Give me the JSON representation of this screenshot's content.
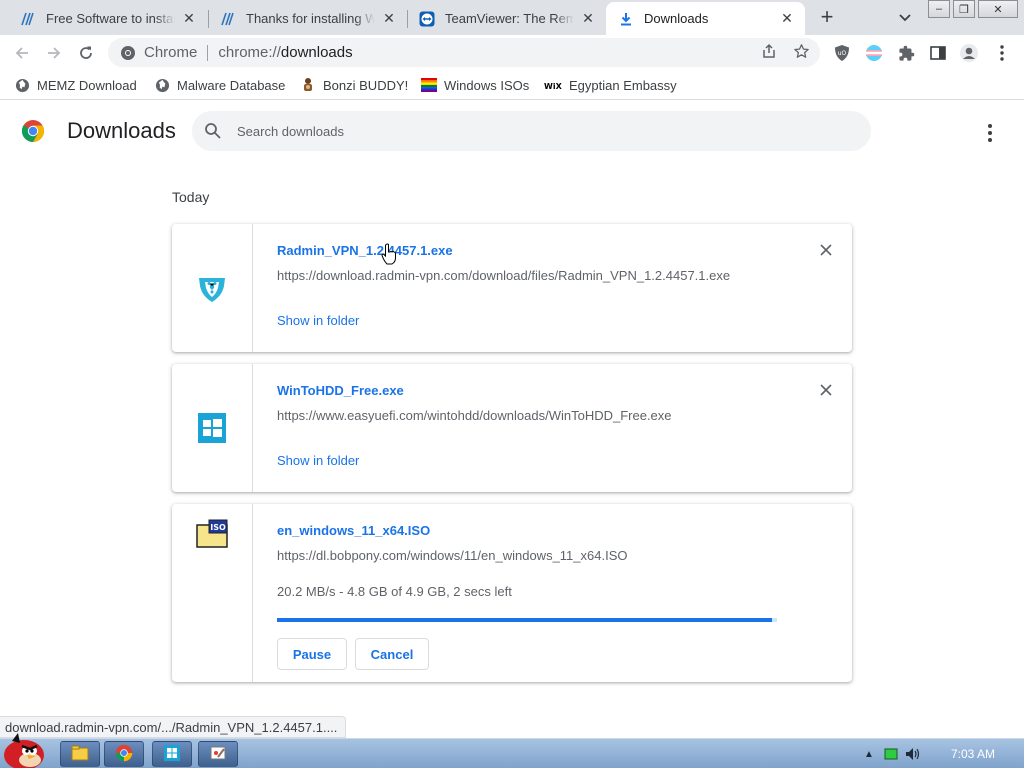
{
  "tabs": [
    {
      "title": "Free Software to install",
      "icon": "ninite-icon",
      "active": false
    },
    {
      "title": "Thanks for installing Wi",
      "icon": "ninite-icon",
      "active": false
    },
    {
      "title": "TeamViewer: The Remo",
      "icon": "teamviewer-icon",
      "active": false
    },
    {
      "title": "Downloads",
      "icon": "download-icon",
      "active": true
    }
  ],
  "window_controls": {
    "minimize": "–",
    "restore": "❐",
    "close": "✕"
  },
  "omnibox": {
    "scheme_label": "Chrome",
    "url_prefix": "chrome://",
    "url_host": "downloads"
  },
  "bookmarks": [
    {
      "label": "MEMZ Download",
      "icon": "globe-icon"
    },
    {
      "label": "Malware Database",
      "icon": "globe-icon"
    },
    {
      "label": "Bonzi BUDDY!",
      "icon": "bonzi-icon"
    },
    {
      "label": "Windows ISOs",
      "icon": "rainbow-flag-icon"
    },
    {
      "label": "Egyptian Embassy",
      "icon": "wix-icon"
    }
  ],
  "page": {
    "title": "Downloads",
    "search_placeholder": "Search downloads",
    "date_label": "Today"
  },
  "downloads": [
    {
      "filename": "Radmin_VPN_1.2.4457.1.exe",
      "url": "https://download.radmin-vpn.com/download/files/Radmin_VPN_1.2.4457.1.exe",
      "action": "Show in folder",
      "icon": "radmin-vpn-icon",
      "state": "complete"
    },
    {
      "filename": "WinToHDD_Free.exe",
      "url": "https://www.easyuefi.com/wintohdd/downloads/WinToHDD_Free.exe",
      "action": "Show in folder",
      "icon": "windows-logo-icon",
      "state": "complete"
    },
    {
      "filename": "en_windows_11_x64.ISO",
      "url": "https://dl.bobpony.com/windows/11/en_windows_11_x64.ISO",
      "status": "20.2 MB/s - 4.8 GB of 4.9 GB, 2 secs left",
      "progress_fraction": 0.99,
      "pause_label": "Pause",
      "cancel_label": "Cancel",
      "icon": "iso-file-icon",
      "state": "in_progress"
    }
  ],
  "status_bubble": "download.radmin-vpn.com/.../Radmin_VPN_1.2.4457.1....",
  "taskbar": {
    "clock": "7:03 AM",
    "apps": [
      "file-explorer-icon",
      "chrome-icon",
      "wintohdd-icon",
      "paint-icon"
    ]
  },
  "colors": {
    "accent": "#1a73e8",
    "tabstrip": "#dee1e6",
    "taskbar": "#7fa3cc"
  }
}
